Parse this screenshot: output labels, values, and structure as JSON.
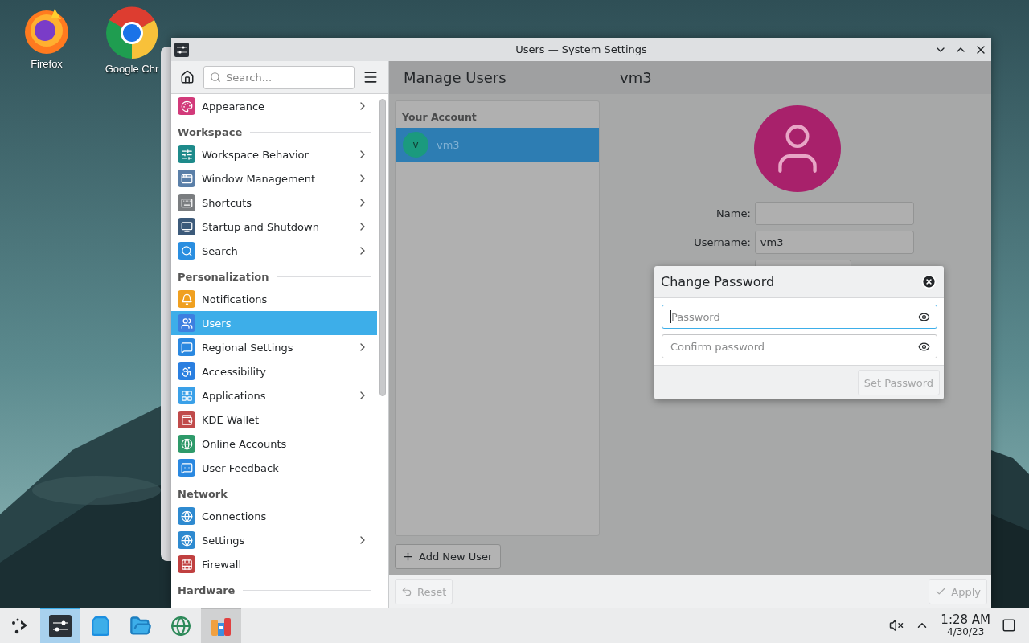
{
  "desktop_icons": [
    {
      "label": "Firefox"
    },
    {
      "label": "Google Chr"
    }
  ],
  "window": {
    "title": "Users — System Settings"
  },
  "sidebar": {
    "search": {
      "placeholder": "Search..."
    },
    "items": [
      {
        "kind": "item",
        "label": "Appearance",
        "arrow": true,
        "selected": false
      },
      {
        "kind": "header",
        "label": "Workspace"
      },
      {
        "kind": "item",
        "label": "Workspace Behavior",
        "arrow": true,
        "selected": false
      },
      {
        "kind": "item",
        "label": "Window Management",
        "arrow": true,
        "selected": false
      },
      {
        "kind": "item",
        "label": "Shortcuts",
        "arrow": true,
        "selected": false
      },
      {
        "kind": "item",
        "label": "Startup and Shutdown",
        "arrow": true,
        "selected": false
      },
      {
        "kind": "item",
        "label": "Search",
        "arrow": true,
        "selected": false
      },
      {
        "kind": "header",
        "label": "Personalization"
      },
      {
        "kind": "item",
        "label": "Notifications",
        "arrow": false,
        "selected": false
      },
      {
        "kind": "item",
        "label": "Users",
        "arrow": false,
        "selected": true
      },
      {
        "kind": "item",
        "label": "Regional Settings",
        "arrow": true,
        "selected": false
      },
      {
        "kind": "item",
        "label": "Accessibility",
        "arrow": false,
        "selected": false
      },
      {
        "kind": "item",
        "label": "Applications",
        "arrow": true,
        "selected": false
      },
      {
        "kind": "item",
        "label": "KDE Wallet",
        "arrow": false,
        "selected": false
      },
      {
        "kind": "item",
        "label": "Online Accounts",
        "arrow": false,
        "selected": false
      },
      {
        "kind": "item",
        "label": "User Feedback",
        "arrow": false,
        "selected": false
      },
      {
        "kind": "header",
        "label": "Network"
      },
      {
        "kind": "item",
        "label": "Connections",
        "arrow": false,
        "selected": false
      },
      {
        "kind": "item",
        "label": "Settings",
        "arrow": true,
        "selected": false
      },
      {
        "kind": "item",
        "label": "Firewall",
        "arrow": false,
        "selected": false
      },
      {
        "kind": "header",
        "label": "Hardware"
      }
    ]
  },
  "main": {
    "title": "Manage Users",
    "subtitle": "vm3",
    "accounts": {
      "heading": "Your Account",
      "users": [
        {
          "initial": "v",
          "name": "vm3",
          "selected": true
        }
      ]
    },
    "add_user_button": "Add New User",
    "fields": [
      {
        "label": "Name:"
      },
      {
        "label": "Username:",
        "value": "vm3"
      },
      {
        "kind": "field"
      }
    ],
    "footer": {
      "reset": {
        "label": "Reset",
        "disabled": true
      },
      "apply": {
        "label": "Apply",
        "disabled": true
      }
    }
  },
  "dialog": {
    "title": "Change Password",
    "fields": [
      {
        "placeholder": "Password",
        "focused": true
      },
      {
        "placeholder": "Confirm password",
        "focused": false
      }
    ],
    "button": {
      "label": "Set Password",
      "disabled": true
    }
  },
  "taskbar": {
    "items": [
      {
        "selected": false
      },
      {
        "selected": true
      },
      {
        "selected": false
      },
      {
        "selected": false
      },
      {
        "selected": false
      },
      {
        "selected": false,
        "highlighted": true
      }
    ],
    "clock": {
      "time": "1:28 AM",
      "date": "4/30/23"
    }
  }
}
